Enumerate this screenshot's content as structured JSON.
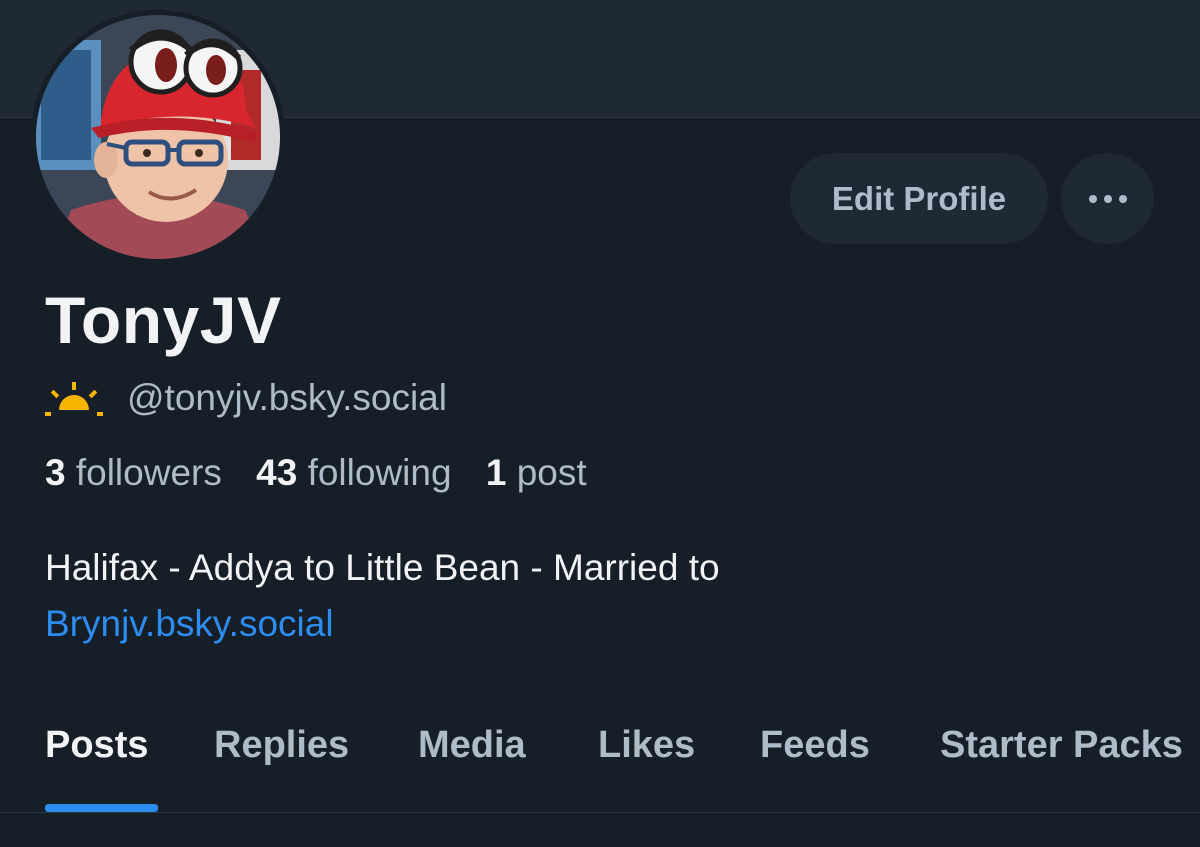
{
  "profile": {
    "display_name": "TonyJV",
    "handle": "@tonyjv.bsky.social",
    "avatar_icon": "profile-photo-avatar",
    "handle_icon": "sunrise-icon"
  },
  "actions": {
    "edit_profile_label": "Edit Profile",
    "more_icon": "more-options-icon"
  },
  "stats": {
    "followers_count": "3",
    "followers_label": "followers",
    "following_count": "43",
    "following_label": "following",
    "posts_count": "1",
    "posts_label": "post"
  },
  "bio": {
    "text": "Halifax - Addya to Little Bean - Married to",
    "link_text": "Brynjv.bsky.social"
  },
  "tabs": [
    {
      "label": "Posts",
      "active": true
    },
    {
      "label": "Replies",
      "active": false
    },
    {
      "label": "Media",
      "active": false
    },
    {
      "label": "Likes",
      "active": false
    },
    {
      "label": "Feeds",
      "active": false
    },
    {
      "label": "Starter Packs",
      "active": false
    }
  ],
  "colors": {
    "background": "#161e27",
    "banner": "#1e2935",
    "accent": "#2d8cf0",
    "muted_text": "#aebbc9",
    "primary_text": "#f1f3f5"
  }
}
